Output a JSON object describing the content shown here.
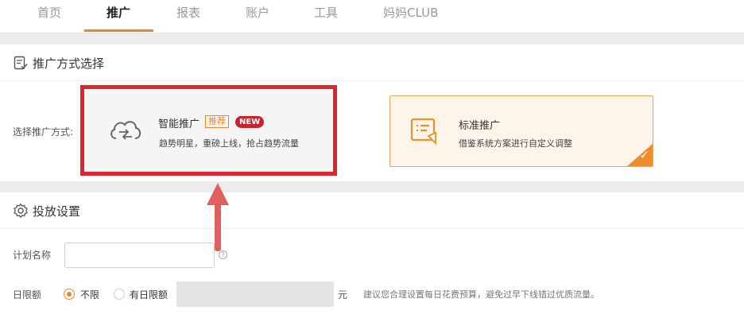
{
  "topnav": {
    "items": [
      {
        "label": "首页",
        "active": false
      },
      {
        "label": "推广",
        "active": true
      },
      {
        "label": "报表",
        "active": false
      },
      {
        "label": "账户",
        "active": false
      },
      {
        "label": "工具",
        "active": false
      },
      {
        "label": "妈妈CLUB",
        "active": false
      }
    ],
    "accent_color": "#e8862a"
  },
  "method_section": {
    "icon": "checklist-icon",
    "title": "推广方式选择",
    "select_label": "选择推广方式:",
    "options": [
      {
        "id": "smart",
        "icon": "cloud-sync-icon",
        "title": "智能推广",
        "badge_recommend": "推荐",
        "badge_new": "NEW",
        "desc": "趋势明星，重磅上线，抢占趋势流量",
        "selected": false
      },
      {
        "id": "standard",
        "icon": "plan-document-icon",
        "title": "标准推广",
        "desc": "借鉴系统方案进行自定义调整",
        "selected": true
      }
    ]
  },
  "settings_section": {
    "icon": "gear-icon",
    "title": "投放设置",
    "plan_name_label": "计划名称",
    "plan_name_value": "",
    "plan_name_placeholder": "",
    "daily_limit_label": "日限额",
    "daily_limit_options": [
      "不限",
      "有日限额"
    ],
    "daily_limit_selected": "不限",
    "daily_limit_unit": "元",
    "daily_limit_hint": "建议您合理设置每日花费预算，避免过早下线错过优质流量。"
  },
  "annotation": {
    "highlight_color": "#e0242e",
    "arrow_color": "#e06060"
  }
}
